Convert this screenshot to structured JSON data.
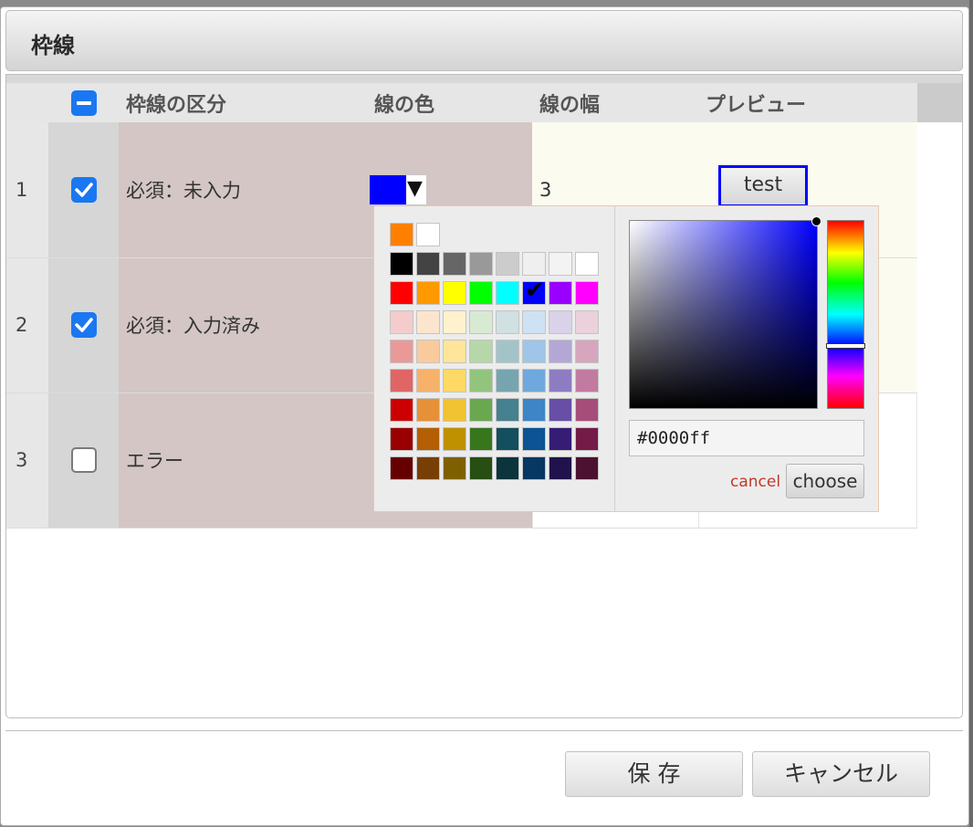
{
  "dialog": {
    "title": "枠線",
    "save_label": "保 存",
    "cancel_label": "キャンセル"
  },
  "table": {
    "headers": {
      "kind": "枠線の区分",
      "color": "線の色",
      "width": "線の幅",
      "preview": "プレビュー"
    },
    "header_checkbox": "indeterminate",
    "rows": [
      {
        "num": "1",
        "checked": true,
        "kind": "必須：未入力",
        "width": "3",
        "preview": "test",
        "color": "#0000ff"
      },
      {
        "num": "2",
        "checked": true,
        "kind": "必須：入力済み"
      },
      {
        "num": "3",
        "checked": false,
        "kind": "エラー"
      }
    ]
  },
  "colorpicker": {
    "hex_value": "#0000ff",
    "cancel_label": "cancel",
    "choose_label": "choose",
    "recent": [
      "#ff8000",
      "#ffffff"
    ],
    "palette": [
      [
        "#000000",
        "#434343",
        "#666666",
        "#999999",
        "#cccccc",
        "#efefef",
        "#f3f3f3",
        "#ffffff"
      ],
      [
        "#ff0000",
        "#ff9900",
        "#ffff00",
        "#00ff00",
        "#00ffff",
        "#0000ff",
        "#9900ff",
        "#ff00ff"
      ],
      [
        "#f4cccc",
        "#fce5cd",
        "#fff2cc",
        "#d9ead3",
        "#d0e0e3",
        "#cfe2f3",
        "#d9d2e9",
        "#ead1dc"
      ],
      [
        "#ea9999",
        "#f9cb9c",
        "#ffe599",
        "#b6d7a8",
        "#a2c4c9",
        "#9fc5e8",
        "#b4a7d6",
        "#d5a6bd"
      ],
      [
        "#e06666",
        "#f6b26b",
        "#ffd966",
        "#93c47d",
        "#76a5af",
        "#6fa8dc",
        "#8e7cc3",
        "#c27ba0"
      ],
      [
        "#cc0000",
        "#e69138",
        "#f1c232",
        "#6aa84f",
        "#45818e",
        "#3d85c6",
        "#674ea7",
        "#a64d79"
      ],
      [
        "#990000",
        "#b45f06",
        "#bf9000",
        "#38761d",
        "#134f5c",
        "#0b5394",
        "#351c75",
        "#741b47"
      ],
      [
        "#660000",
        "#783f04",
        "#7f6000",
        "#274e13",
        "#0c343d",
        "#073763",
        "#20124d",
        "#4c1130"
      ]
    ],
    "selected": "#0000ff"
  }
}
